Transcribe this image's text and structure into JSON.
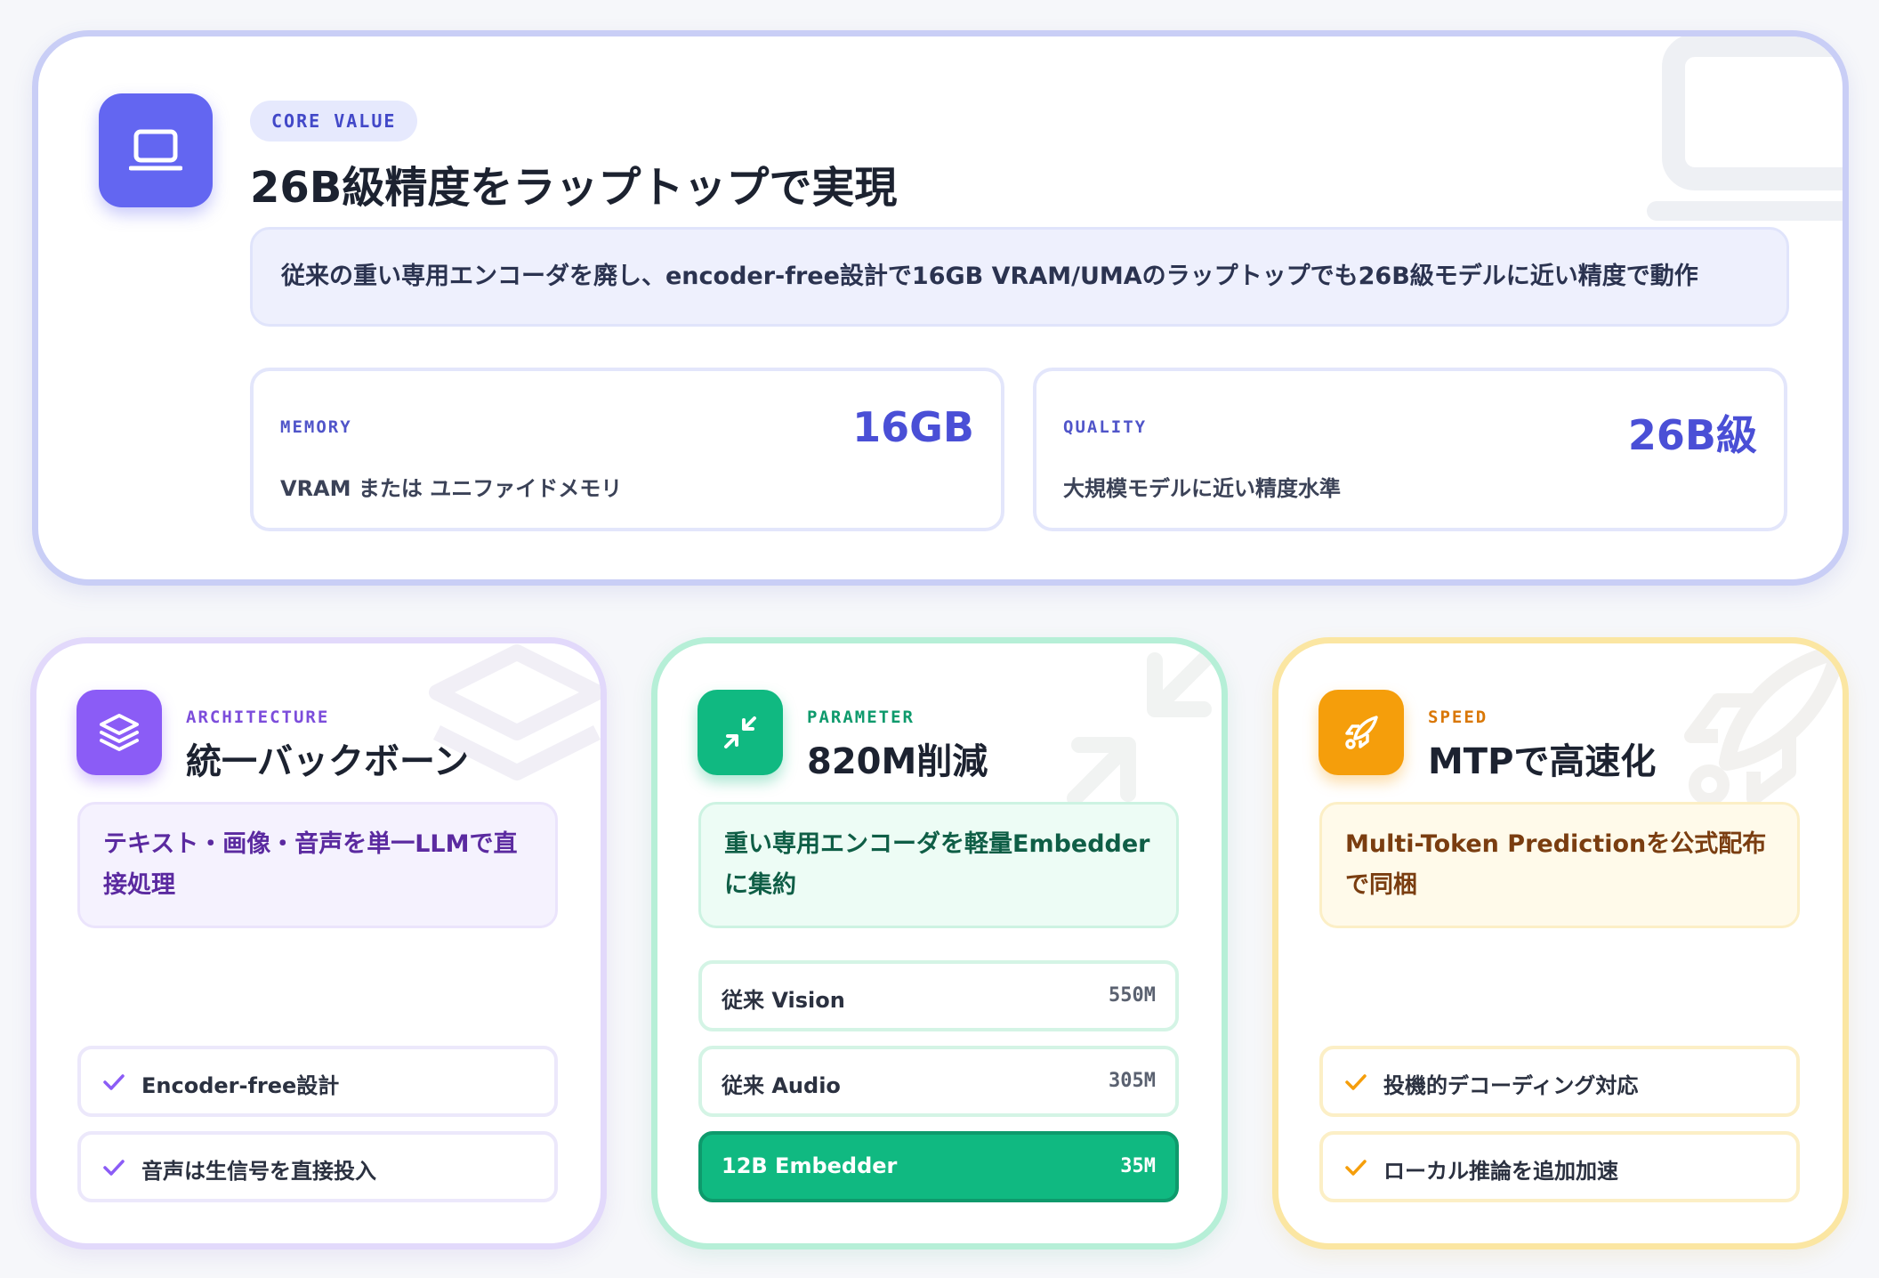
{
  "hero": {
    "pill": "CORE VALUE",
    "title": "26B級精度をラップトップで実現",
    "desc": "従来の重い専用エンコーダを廃し、encoder-free設計で16GB VRAM/UMAのラップトップでも26B級モデルに近い精度で動作",
    "icon": "laptop-icon",
    "stats": [
      {
        "label": "MEMORY",
        "value": "16GB",
        "desc": "VRAM または ユニファイドメモリ"
      },
      {
        "label": "QUALITY",
        "value": "26B級",
        "desc": "大規模モデルに近い精度水準"
      }
    ]
  },
  "cards": {
    "architecture": {
      "kicker": "ARCHITECTURE",
      "title": "統一バックボーン",
      "desc": "テキスト・画像・音声を単一LLMで直接処理",
      "icon": "layers-icon",
      "color": "#8b5cf6",
      "items": [
        "Encoder-free設計",
        "音声は生信号を直接投入"
      ]
    },
    "parameter": {
      "kicker": "PARAMETER",
      "title": "820M削減",
      "desc": "重い専用エンコーダを軽量Embedderに集約",
      "icon": "minimize-icon",
      "color": "#10b981",
      "rows": [
        {
          "label": "従来 Vision",
          "value": "550M"
        },
        {
          "label": "従来 Audio",
          "value": "305M"
        },
        {
          "label": "12B Embedder",
          "value": "35M"
        }
      ]
    },
    "speed": {
      "kicker": "SPEED",
      "title": "MTPで高速化",
      "desc": "Multi-Token Predictionを公式配布で同梱",
      "icon": "rocket-icon",
      "color": "#f59e0b",
      "items": [
        "投機的デコーディング対応",
        "ローカル推論を追加加速"
      ]
    }
  }
}
